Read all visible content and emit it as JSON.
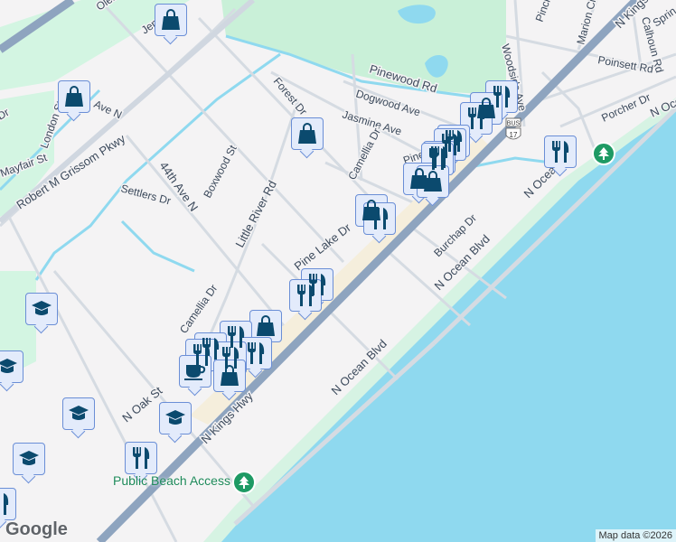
{
  "map": {
    "streets": {
      "robert_m_grissom": "Robert M Grissom Pkwy",
      "ave_44th": "44th Ave N",
      "little_river": "Little River Rd",
      "pine_lake": "Pine Lake Dr",
      "pinewood": "Pinewood Rd",
      "dogwood": "Dogwood Ave",
      "jasmine": "Jasmine Ave",
      "camellia": "Camellia Dr",
      "camellia2": "Camellia Dr",
      "forest": "Forest Dr",
      "boxwood": "Boxwood St",
      "settlers": "Settlers Dr",
      "london": "London St",
      "mayfair": "Mayfair St",
      "ave_n": "Ave N",
      "n_oak": "N Oak St",
      "n_kings_hwy": "N Kings Hwy",
      "n_kings_hwy_top": "N Kings",
      "n_ocean_blvd_1": "N Ocean Blvd",
      "n_ocean_blvd_2": "N Ocean Blvd",
      "n_ocean_blvd_3": "N Ocea",
      "n_ocean_blvd_4": "N Ocea",
      "burchap": "Burchap Dr",
      "porcher": "Porcher Dr",
      "poinsett": "Poinsett Rd",
      "calhoun": "Calhoun Rd",
      "marion": "Marion Cir",
      "woodside": "Woodside Ave",
      "pinckney": "Pinckn",
      "spring": "Sprin",
      "oleander": "Olea",
      "jen": "Jen",
      "dr_left": "Dr",
      "pine_partial": "Pine"
    },
    "route_shield": {
      "top": "BUS",
      "number": "17"
    },
    "poi": {
      "public_beach_access": "Public Beach Access"
    },
    "logo": "Google",
    "attribution": "Map data ©2026",
    "colors": {
      "water": "#8fd9ef",
      "park": "#d3f5e2",
      "highway": "#8ea4bf",
      "marker_icon": "#0b4a6e"
    }
  }
}
